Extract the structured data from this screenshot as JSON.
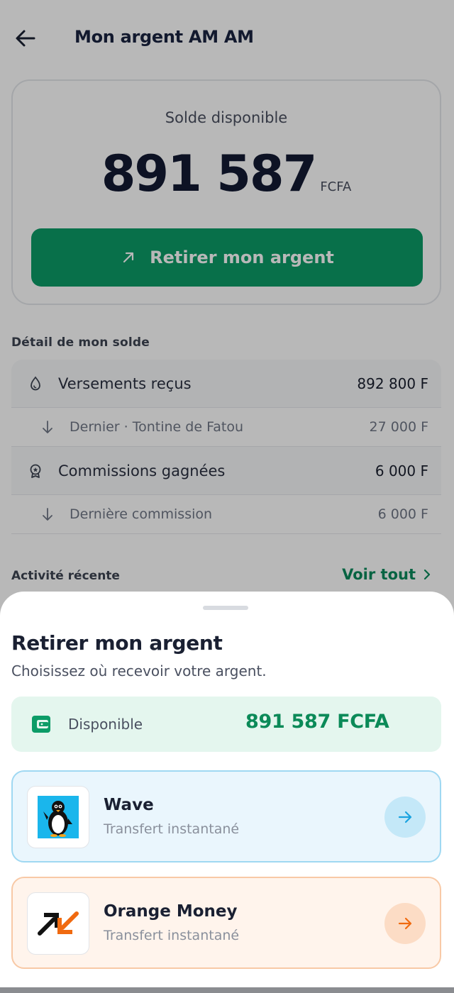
{
  "header": {
    "title": "Mon argent AM AM",
    "back_icon": "arrow-left-icon"
  },
  "balance": {
    "label": "Solde disponible",
    "amount": "891 587",
    "currency": "FCFA",
    "withdraw_label": "Retirer mon argent",
    "withdraw_icon": "arrow-up-right-icon"
  },
  "detail": {
    "section_label": "Détail de mon solde",
    "rows": [
      {
        "type": "main",
        "icon": "drop-icon",
        "label": "Versements reçus",
        "value": "892 800 F"
      },
      {
        "type": "sub",
        "icon": "arrow-down-icon",
        "label": "Dernier · Tontine de Fatou",
        "value": "27 000 F"
      },
      {
        "type": "main",
        "icon": "award-icon",
        "label": "Commissions gagnées",
        "value": "6 000 F"
      },
      {
        "type": "sub",
        "icon": "arrow-down-icon",
        "label": "Dernière commission",
        "value": "6 000 F"
      }
    ]
  },
  "recent": {
    "label": "Activité récente",
    "see_all": "Voir tout"
  },
  "sheet": {
    "title": "Retirer mon argent",
    "subtitle": "Choisissez où recevoir votre argent.",
    "available_label": "Disponible",
    "available_amount": "891 587 FCFA",
    "options": [
      {
        "name": "Wave",
        "subtitle": "Transfert instantané",
        "logo": "wave-penguin-icon",
        "accent": "#1aa3e0"
      },
      {
        "name": "Orange Money",
        "subtitle": "Transfert instantané",
        "logo": "orange-money-arrows-icon",
        "accent": "#f06a10"
      }
    ]
  },
  "colors": {
    "primary_green": "#0c9c67",
    "available_bg": "#e4f6ee",
    "wave_bg": "#eaf6fd",
    "orange_bg": "#fff4ec"
  }
}
